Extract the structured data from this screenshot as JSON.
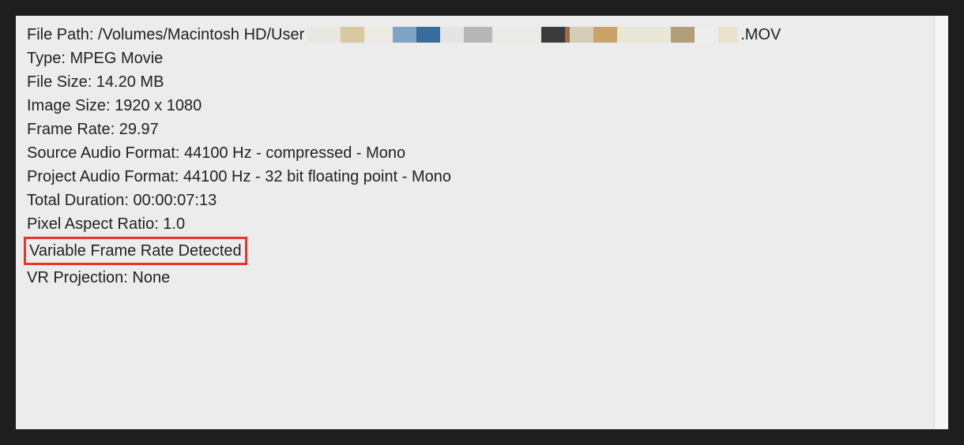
{
  "properties": {
    "file_path_label": "File Path:",
    "file_path_prefix": "/Volumes/Macintosh HD/User",
    "file_path_suffix": ".MOV",
    "type_label": "Type:",
    "type_value": "MPEG Movie",
    "file_size_label": "File Size:",
    "file_size_value": "14.20 MB",
    "image_size_label": "Image Size:",
    "image_size_value": "1920 x 1080",
    "frame_rate_label": "Frame Rate:",
    "frame_rate_value": "29.97",
    "source_audio_label": "Source Audio Format:",
    "source_audio_value": "44100 Hz - compressed - Mono",
    "project_audio_label": "Project Audio Format:",
    "project_audio_value": "44100 Hz - 32 bit floating point - Mono",
    "total_duration_label": "Total Duration:",
    "total_duration_value": "00:00:07:13",
    "pixel_aspect_label": "Pixel Aspect Ratio:",
    "pixel_aspect_value": "1.0",
    "vfr_detected": "Variable Frame Rate Detected",
    "vr_projection_label": "VR Projection:",
    "vr_projection_value": "None"
  },
  "redaction_colors": [
    {
      "c": "#e8e8e0",
      "w": 42
    },
    {
      "c": "#d9c9a0",
      "w": 30
    },
    {
      "c": "#eceae3",
      "w": 36
    },
    {
      "c": "#7ea3c5",
      "w": 30
    },
    {
      "c": "#376d9b",
      "w": 30
    },
    {
      "c": "#e2e4e6",
      "w": 30
    },
    {
      "c": "#b6b8b6",
      "w": 36
    },
    {
      "c": "#eaeae6",
      "w": 62
    },
    {
      "c": "#3b3b3b",
      "w": 30
    },
    {
      "c": "#9b6e4a",
      "w": 6
    },
    {
      "c": "#d4cdb8",
      "w": 30
    },
    {
      "c": "#c9a36a",
      "w": 30
    },
    {
      "c": "#e9e5d7",
      "w": 68
    },
    {
      "c": "#b19d77",
      "w": 30
    },
    {
      "c": "#ededed",
      "w": 30
    },
    {
      "c": "#e9e1ce",
      "w": 24
    }
  ]
}
